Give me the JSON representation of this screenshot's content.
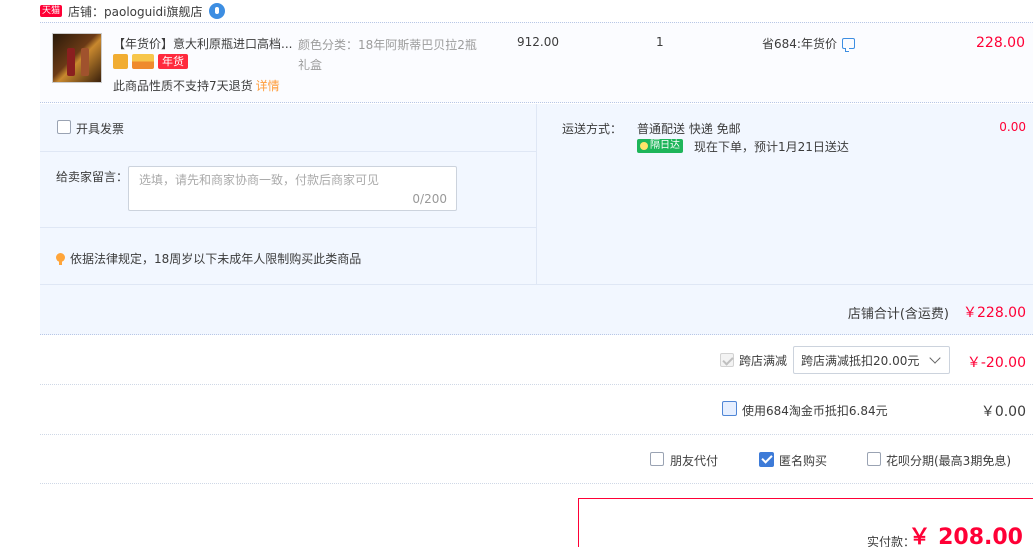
{
  "shop": {
    "badge": "天猫",
    "label": "店铺：paologuidi旗舰店"
  },
  "item": {
    "title": "【年货价】意大利原瓶进口高档...",
    "tag_nianhuo": "年货",
    "note": "此商品性质不支持7天退货",
    "detail_link": "详情",
    "sku": "颜色分类：18年阿斯蒂巴贝拉2瓶礼盒",
    "price": "912.00",
    "quantity": "1",
    "promo": "省684:年货价",
    "subtotal": "228.00"
  },
  "invoice": {
    "label": "开具发票"
  },
  "message": {
    "label": "给卖家留言：",
    "placeholder": "选填，请先和商家协商一致，付款后商家可见",
    "counter": "0/200"
  },
  "law_tip": "依据法律规定，18周岁以下未成年人限制购买此类商品",
  "shipping": {
    "label": "运送方式：",
    "method": "普通配送 快递 免邮",
    "badge": "隔日达",
    "eta": "现在下单，预计1月21日送达",
    "fee": "0.00"
  },
  "shop_total": {
    "label": "店铺合计(含运费)",
    "value": "￥228.00"
  },
  "cross_discount": {
    "label": "跨店满减",
    "selected": "跨店满减抵扣20.00元",
    "value": "￥-20.00"
  },
  "coins": {
    "label": "使用684淘金币抵扣6.84元",
    "value": "￥0.00"
  },
  "options": {
    "friend_pay": "朋友代付",
    "anonymous": "匿名购买",
    "installment": "花呗分期(最高3期免息)"
  },
  "payment": {
    "label": "实付款：",
    "value": "￥ 208.00"
  }
}
